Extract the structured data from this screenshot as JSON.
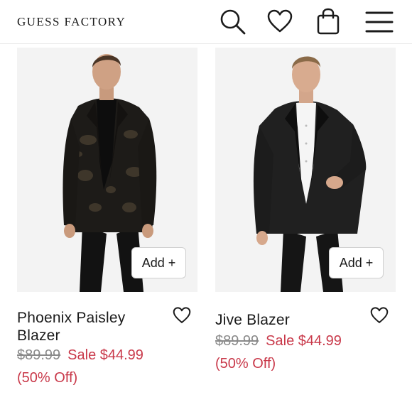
{
  "header": {
    "brand": "GUESS FACTORY",
    "icons": [
      "search-icon",
      "heart-icon",
      "shopping-bag-icon",
      "menu-icon"
    ]
  },
  "products": [
    {
      "name": "Phoenix Paisley Blazer",
      "original_price": "$89.99",
      "sale_price": "Sale $44.99",
      "discount": "(50% Off)",
      "add_label": "Add +"
    },
    {
      "name": "Jive Blazer",
      "original_price": "$89.99",
      "sale_price": "Sale $44.99",
      "discount": "(50% Off)",
      "add_label": "Add +"
    }
  ],
  "colors": {
    "sale_red": "#c9394a",
    "strike_gray": "#8a8a8a",
    "photo_bg": "#f3f3f3"
  }
}
